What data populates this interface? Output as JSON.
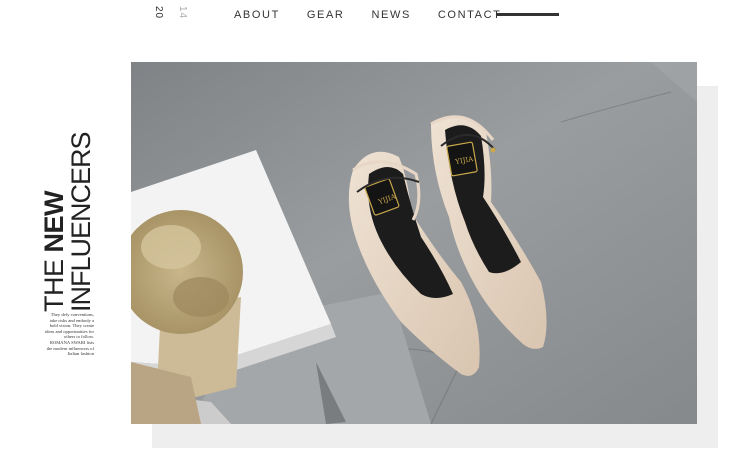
{
  "header": {
    "year_part1": "20",
    "year_part2": "14",
    "nav": [
      {
        "label": "ABOUT"
      },
      {
        "label": "GEAR"
      },
      {
        "label": "NEWS"
      },
      {
        "label": "CONTACT"
      }
    ]
  },
  "hero": {
    "headline_thin": "THE",
    "headline_bold": "NEW",
    "headline_line2": "INFLUENCERS",
    "blurb": "They defy conventions, take risks and embody a bold vision. They create ideas and opportunities for others to follow. ROMANA SWARI lists the modern influencers of Italian fashion",
    "shoe_label": "YIJIA"
  },
  "colors": {
    "text": "#222222",
    "concrete": "#8f9294",
    "shoe": "#e8d7c6",
    "insole": "#1c1c1c",
    "accent_gold": "#c9a74a"
  }
}
